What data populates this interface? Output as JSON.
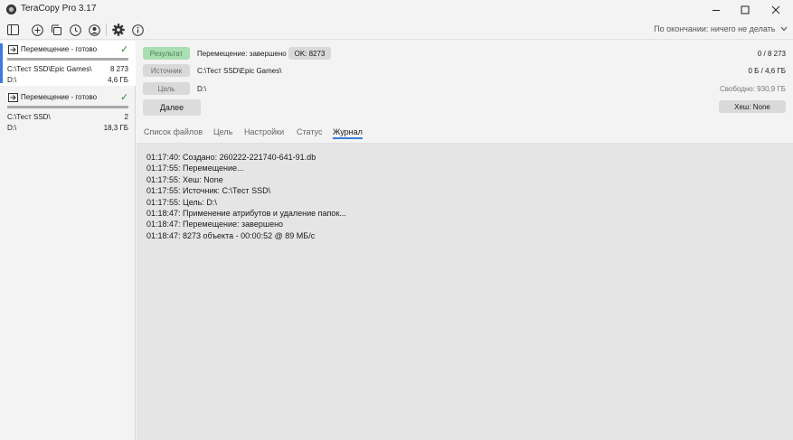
{
  "window": {
    "title": "TeraCopy Pro 3.17"
  },
  "toolbar": {
    "on_complete": "По окончании: ничего не делать"
  },
  "jobs": [
    {
      "title": "Перемещение - готово",
      "source": "C:\\Тест SSD\\Epic Games\\",
      "count": "8 273",
      "target": "D:\\",
      "size": "4,6 ГБ"
    },
    {
      "title": "Перемещение - готово",
      "source": "C:\\Тест SSD\\",
      "count": "2",
      "target": "D:\\",
      "size": "18,3 ГБ"
    }
  ],
  "summary": {
    "result_label": "Результат",
    "status_text": "Перемещение: завершено",
    "ok_badge": "OK: 8273",
    "files_progress": "0 / 8 273",
    "source_label": "Источник",
    "source_path": "C:\\Тест SSD\\Epic Games\\",
    "bytes_progress": "0 Б / 4,6 ГБ",
    "target_label": "Цель",
    "target_path": "D:\\",
    "free_space": "Свободно: 930,9 ГБ",
    "next_button": "Далее",
    "hash_button": "Хеш: None"
  },
  "tabs": [
    "Список файлов",
    "Цель",
    "Настройки",
    "Статус",
    "Журнал"
  ],
  "active_tab": "Журнал",
  "log": [
    "01:17:40: Создано: 260222-221740-641-91.db",
    "01:17:55: Перемещение...",
    "01:17:55: Хеш: None",
    "01:17:55: Источник: C:\\Тест SSD\\",
    "01:17:55: Цель: D:\\",
    "01:18:47: Применение атрибутов и удаление папок...",
    "01:18:47: Перемещение: завершено",
    "01:18:47: 8273 объекта - 00:00:52 @ 89 МБ/с"
  ],
  "colors": {
    "accent": "#3b7dd8",
    "result_green": "#a9dfb1",
    "check_green": "#2e8b3a"
  },
  "icons": [
    "sidebar-toggle-icon",
    "add-icon",
    "copy-icon",
    "history-icon",
    "account-icon",
    "gear-icon",
    "info-icon",
    "check-icon",
    "job-move-icon",
    "minimize-icon",
    "maximize-icon",
    "close-icon",
    "chevron-down-icon"
  ]
}
